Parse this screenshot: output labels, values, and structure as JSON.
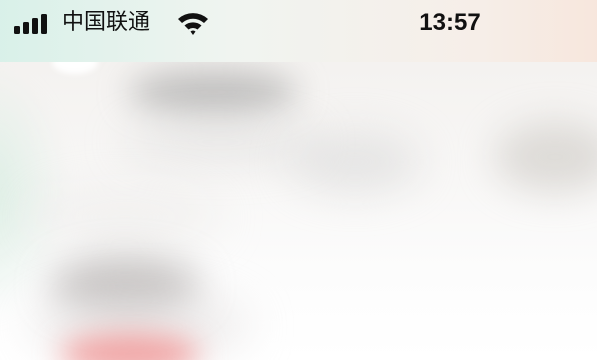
{
  "status_bar": {
    "carrier": "中国联通",
    "time": "13:57",
    "signal_bars": 4,
    "wifi_icon": "wifi-icon",
    "signal_icon": "cellular-signal-icon"
  },
  "colors": {
    "status_text": "#111111",
    "background_top": "#f4f2f0",
    "background_bottom": "#ffffff",
    "accent_blur": "#f08a8a"
  }
}
